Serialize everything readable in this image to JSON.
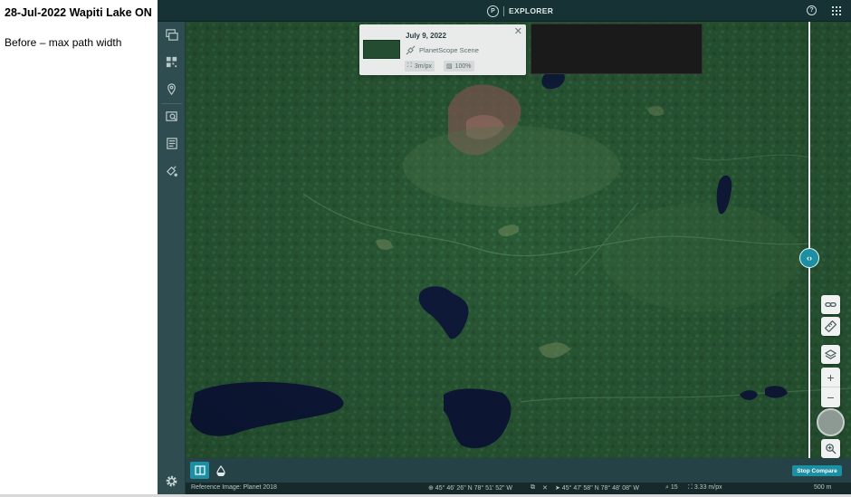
{
  "document": {
    "title": "28-Jul-2022 Wapiti Lake ON",
    "note": "Before – max path width"
  },
  "header": {
    "brand_letter": "P",
    "brand_label": "EXPLORER",
    "help_glyph": "?"
  },
  "sidenav": {
    "items": [
      {
        "name": "scenes-icon"
      },
      {
        "name": "mosaics-icon"
      },
      {
        "name": "places-icon"
      },
      {
        "name": "saved-search-icon"
      },
      {
        "name": "reports-icon"
      },
      {
        "name": "tasking-icon"
      }
    ]
  },
  "scene_card": {
    "date": "July 9, 2022",
    "type": "PlanetScope Scene",
    "resolution": "3m/px",
    "coverage": "100%",
    "close_glyph": "✕"
  },
  "compare": {
    "swap_glyph": "⇄",
    "handle_glyph": "‹›",
    "stop_label": "Stop Compare"
  },
  "tools": {
    "zoom_in": "+",
    "zoom_out": "−"
  },
  "status": {
    "reference": "Reference Image: Planet 2018",
    "cursor_coord": "⊕ 45° 46' 26\" N 78° 51' 52\" W",
    "center_coord": "➤ 45° 47' 58\" N 78° 48' 08\" W",
    "zoom": "⌕ 15",
    "resolution": "⛶ 3.33 m/px",
    "scale": "500 m"
  },
  "colors": {
    "accent": "#1c8fa3",
    "chrome": "#1c3a3e",
    "forest": "#2a5a36"
  }
}
